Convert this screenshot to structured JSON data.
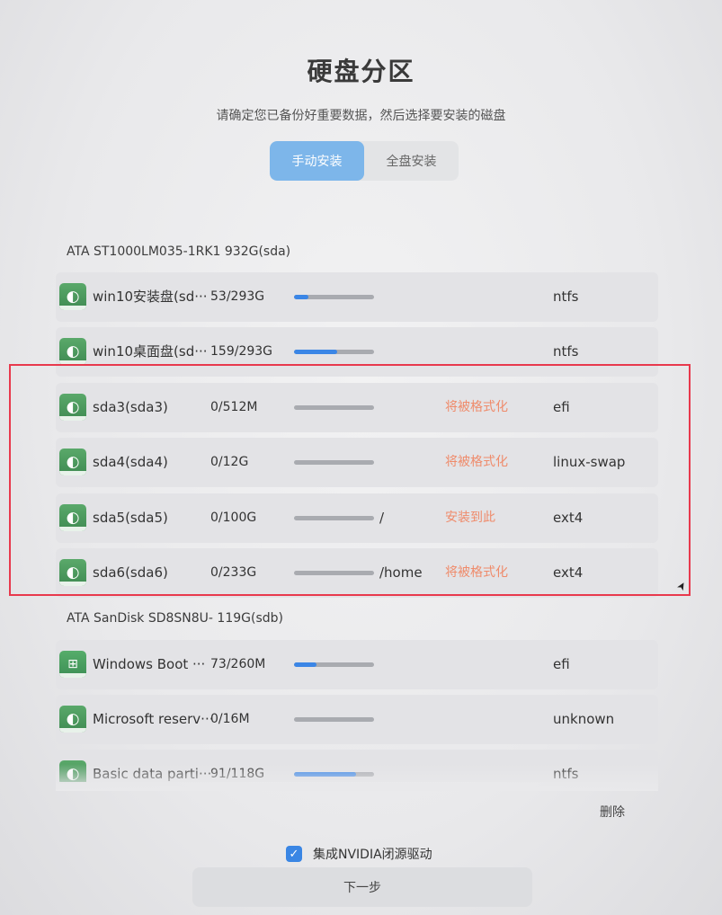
{
  "header": {
    "title": "硬盘分区",
    "subtitle": "请确定您已备份好重要数据，然后选择要安装的磁盘"
  },
  "modes": {
    "manual": "手动安装",
    "full": "全盘安装",
    "active": "manual"
  },
  "disks": [
    {
      "label": "ATA ST1000LM035-1RK1 932G(sda)"
    },
    {
      "label": "ATA SanDisk SD8SN8U- 119G(sdb)"
    }
  ],
  "rows": [
    {
      "icon": "deepin-icon",
      "name": "win10安装盘(sd···",
      "size": "53/293G",
      "usage": 0.18,
      "mount": "",
      "status": "",
      "fs": "ntfs"
    },
    {
      "icon": "deepin-icon",
      "name": "win10桌面盘(sd···",
      "size": "159/293G",
      "usage": 0.54,
      "mount": "",
      "status": "",
      "fs": "ntfs"
    },
    {
      "icon": "deepin-icon",
      "name": "sda3(sda3)",
      "size": "0/512M",
      "usage": 0,
      "mount": "",
      "status": "将被格式化",
      "fs": "efi"
    },
    {
      "icon": "deepin-icon",
      "name": "sda4(sda4)",
      "size": "0/12G",
      "usage": 0,
      "mount": "",
      "status": "将被格式化",
      "fs": "linux-swap"
    },
    {
      "icon": "deepin-icon",
      "name": "sda5(sda5)",
      "size": "0/100G",
      "usage": 0,
      "mount": "/",
      "status": "安装到此",
      "fs": "ext4"
    },
    {
      "icon": "deepin-icon",
      "name": "sda6(sda6)",
      "size": "0/233G",
      "usage": 0,
      "mount": "/home",
      "status": "将被格式化",
      "fs": "ext4"
    },
    {
      "icon": "windows-icon",
      "name": "Windows Boot ···",
      "size": "73/260M",
      "usage": 0.28,
      "mount": "",
      "status": "",
      "fs": "efi"
    },
    {
      "icon": "deepin-icon",
      "name": "Microsoft reserv···",
      "size": "0/16M",
      "usage": 0,
      "mount": "",
      "status": "",
      "fs": "unknown"
    },
    {
      "icon": "deepin-icon",
      "name": "Basic data parti···",
      "size": "91/118G",
      "usage": 0.77,
      "mount": "",
      "status": "",
      "fs": "ntfs"
    }
  ],
  "footer": {
    "delete_label": "删除",
    "nvidia_label": "集成NVIDIA闭源驱动",
    "nvidia_checked": true,
    "next_label": "下一步"
  },
  "colors": {
    "accent": "#3b86e6",
    "status": "#ef8b6b",
    "highlight": "#e8394d"
  }
}
